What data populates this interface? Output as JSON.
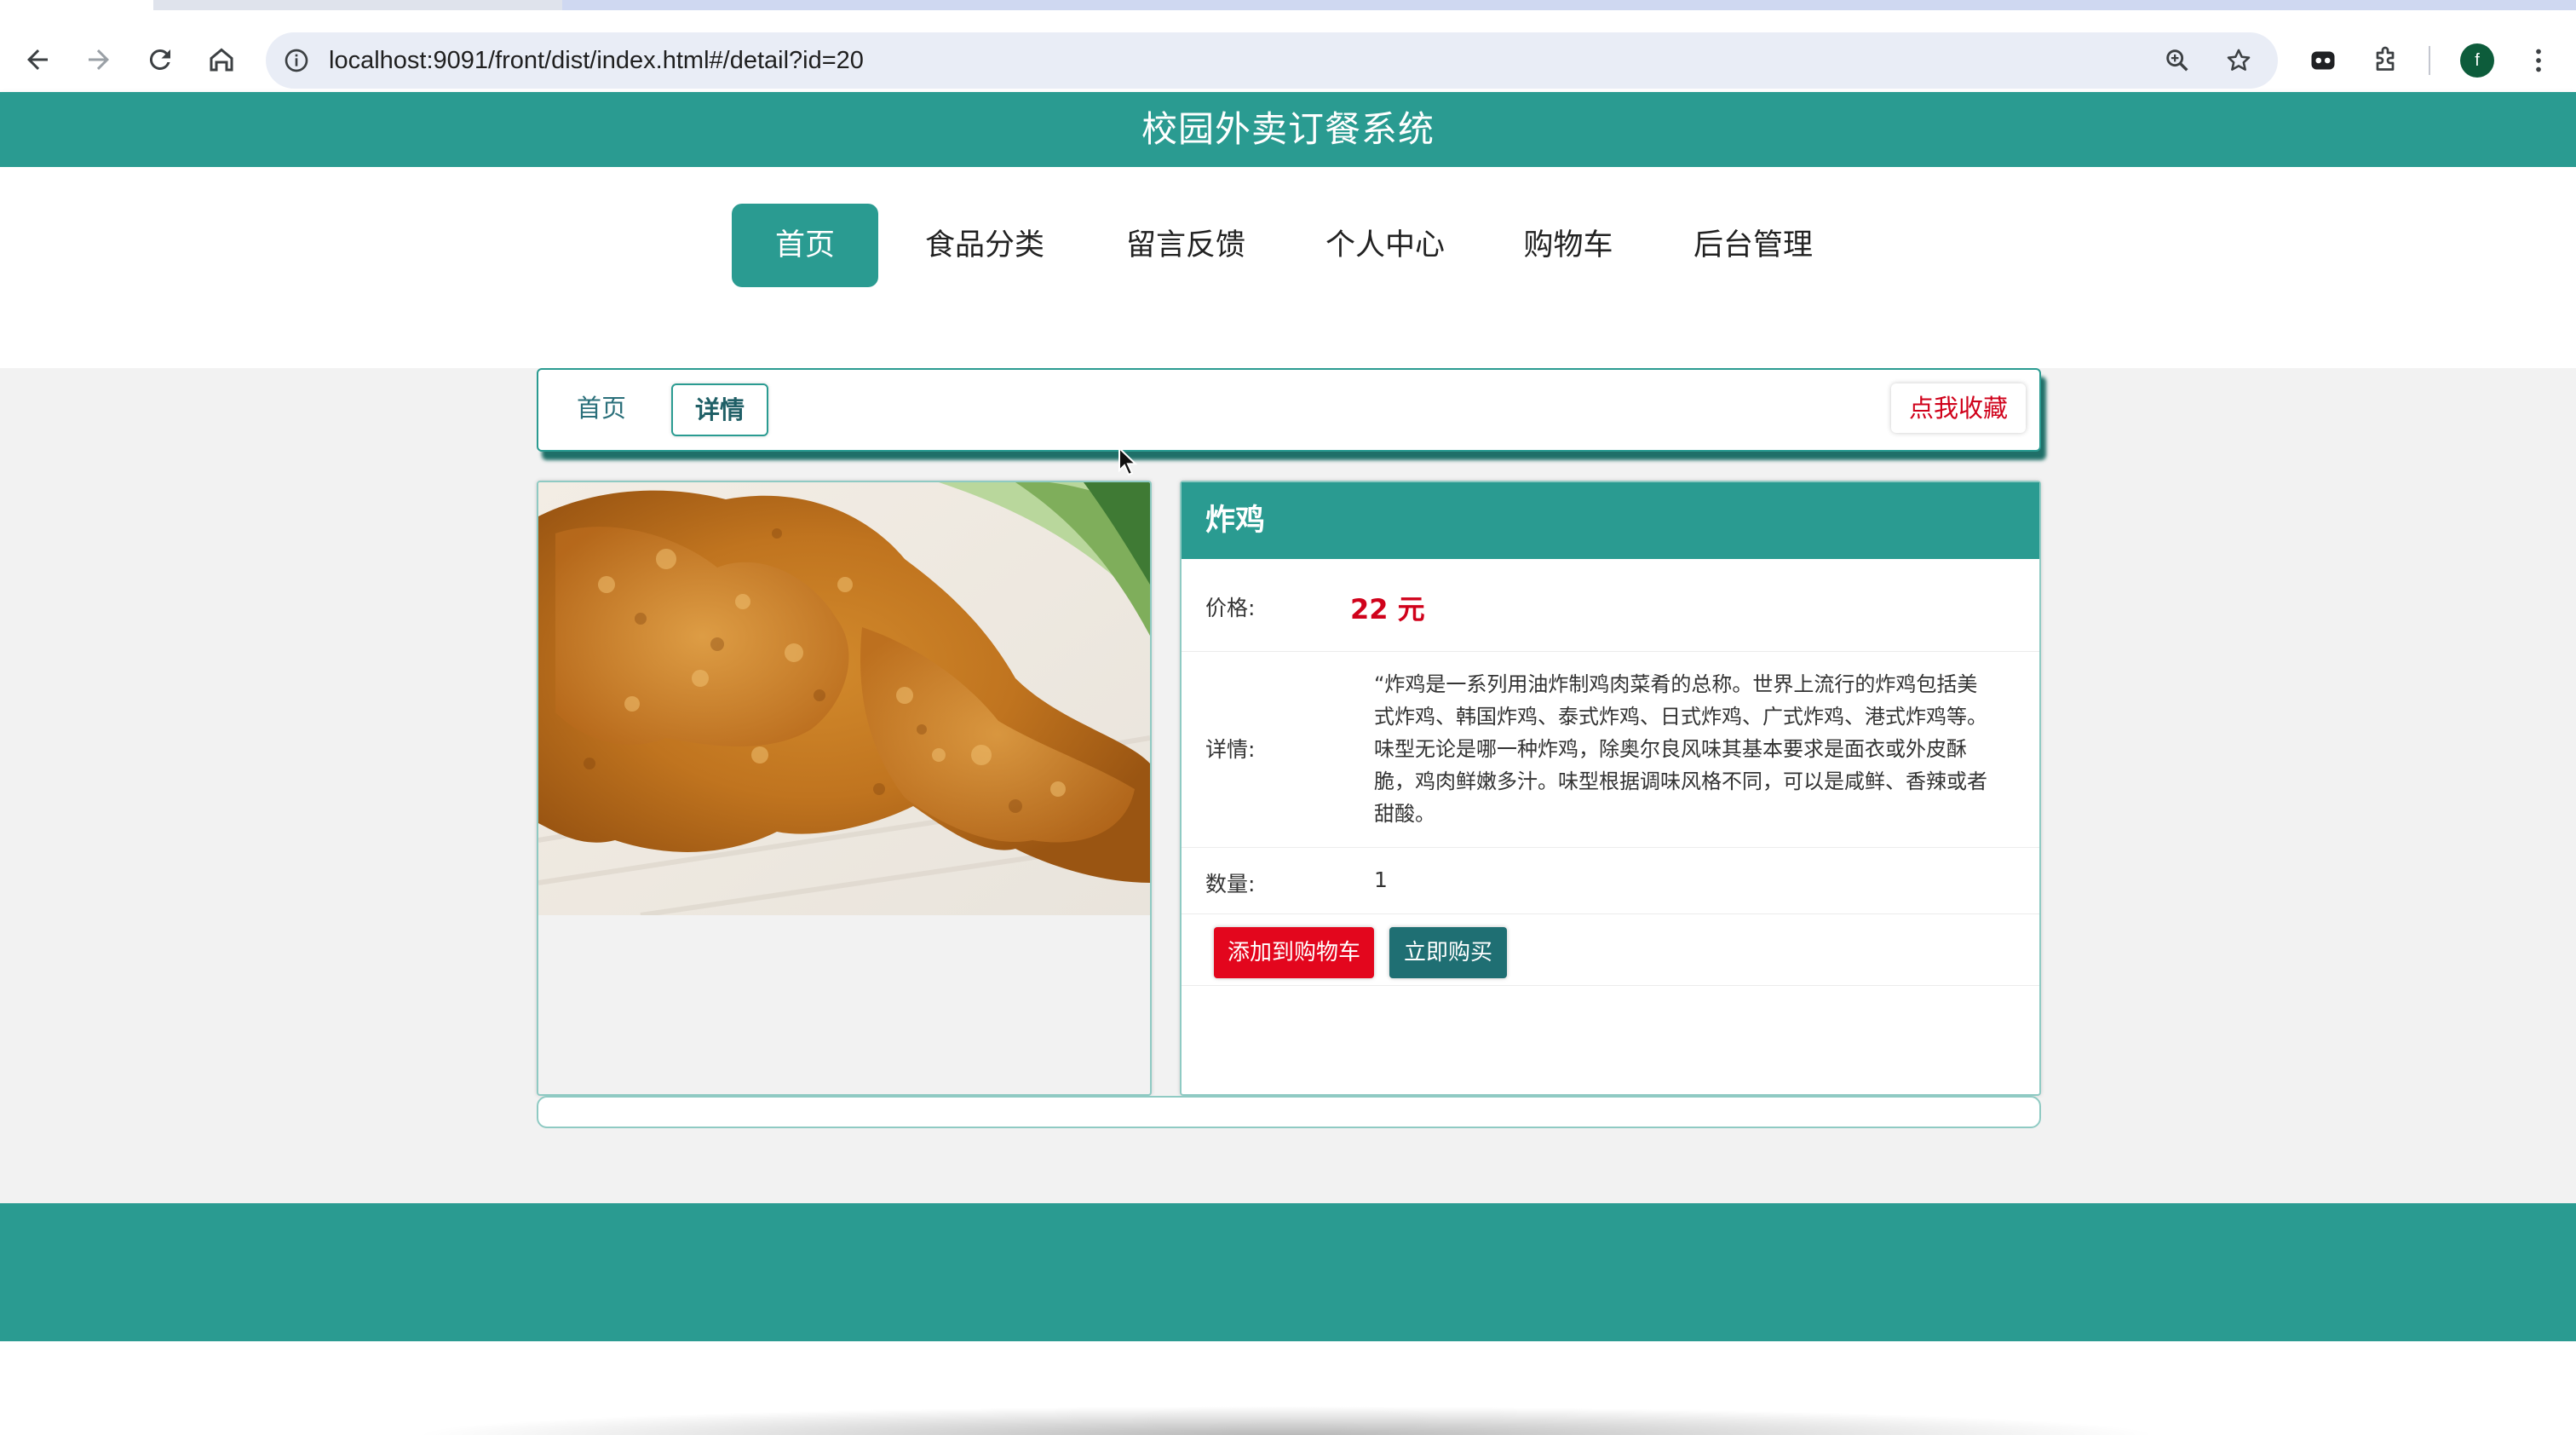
{
  "browser": {
    "url": "localhost:9091/front/dist/index.html#/detail?id=20",
    "profile_initial": "f"
  },
  "site": {
    "title": "校园外卖订餐系统"
  },
  "nav": {
    "items": [
      {
        "label": "首页",
        "active": true
      },
      {
        "label": "食品分类",
        "active": false
      },
      {
        "label": "留言反馈",
        "active": false
      },
      {
        "label": "个人中心",
        "active": false
      },
      {
        "label": "购物车",
        "active": false
      },
      {
        "label": "后台管理",
        "active": false
      }
    ]
  },
  "breadcrumb": {
    "home": "首页",
    "current": "详情",
    "favorite_label": "点我收藏"
  },
  "product": {
    "name": "炸鸡",
    "price_label": "价格:",
    "price": "22 元",
    "detail_label": "详情:",
    "description": "“炸鸡是一系列用油炸制鸡肉菜肴的总称。世界上流行的炸鸡包括美式炸鸡、韩国炸鸡、泰式炸鸡、日式炸鸡、广式炸鸡、港式炸鸡等。味型无论是哪一种炸鸡，除奥尔良风味其基本要求是面衣或外皮酥脆，鸡肉鲜嫩多汁。味型根据调味风格不同，可以是咸鲜、香辣或者甜酸。",
    "quantity_label": "数量:",
    "quantity": "1",
    "add_to_cart_label": "添加到购物车",
    "buy_now_label": "立即购买"
  },
  "colors": {
    "brand": "#2a9b91",
    "price": "#d0021b",
    "add_cart_button": "#e3061d",
    "buy_button": "#1f6f73"
  }
}
